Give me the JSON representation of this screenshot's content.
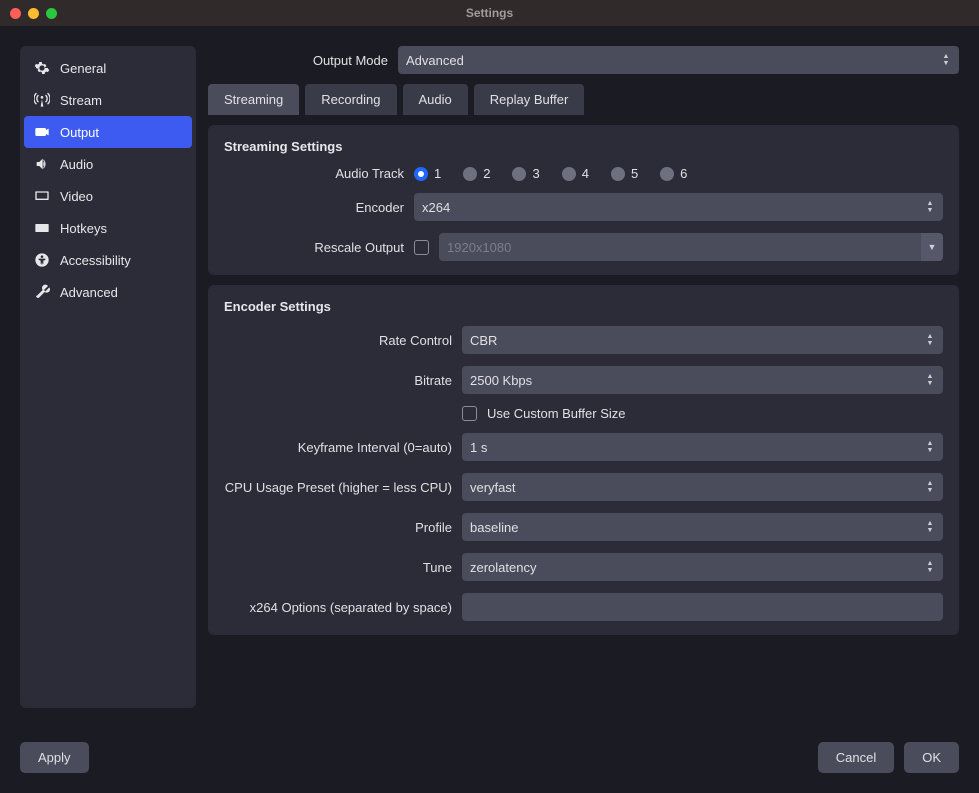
{
  "window": {
    "title": "Settings"
  },
  "sidebar": {
    "items": [
      {
        "label": "General"
      },
      {
        "label": "Stream"
      },
      {
        "label": "Output"
      },
      {
        "label": "Audio"
      },
      {
        "label": "Video"
      },
      {
        "label": "Hotkeys"
      },
      {
        "label": "Accessibility"
      },
      {
        "label": "Advanced"
      }
    ]
  },
  "output_mode": {
    "label": "Output Mode",
    "value": "Advanced"
  },
  "tabs": {
    "streaming": "Streaming",
    "recording": "Recording",
    "audio": "Audio",
    "replay": "Replay Buffer"
  },
  "streaming_settings": {
    "heading": "Streaming Settings",
    "audio_track": {
      "label": "Audio Track",
      "options": [
        "1",
        "2",
        "3",
        "4",
        "5",
        "6"
      ],
      "selected": "1"
    },
    "encoder": {
      "label": "Encoder",
      "value": "x264"
    },
    "rescale": {
      "label": "Rescale Output",
      "value": "1920x1080"
    }
  },
  "encoder_settings": {
    "heading": "Encoder Settings",
    "rate_control": {
      "label": "Rate Control",
      "value": "CBR"
    },
    "bitrate": {
      "label": "Bitrate",
      "value": "2500 Kbps"
    },
    "custom_buffer": {
      "label": "Use Custom Buffer Size"
    },
    "keyframe": {
      "label": "Keyframe Interval (0=auto)",
      "value": "1 s"
    },
    "cpu_preset": {
      "label": "CPU Usage Preset (higher = less CPU)",
      "value": "veryfast"
    },
    "profile": {
      "label": "Profile",
      "value": "baseline"
    },
    "tune": {
      "label": "Tune",
      "value": "zerolatency"
    },
    "x264_options": {
      "label": "x264 Options (separated by space)",
      "value": ""
    }
  },
  "buttons": {
    "apply": "Apply",
    "cancel": "Cancel",
    "ok": "OK"
  }
}
